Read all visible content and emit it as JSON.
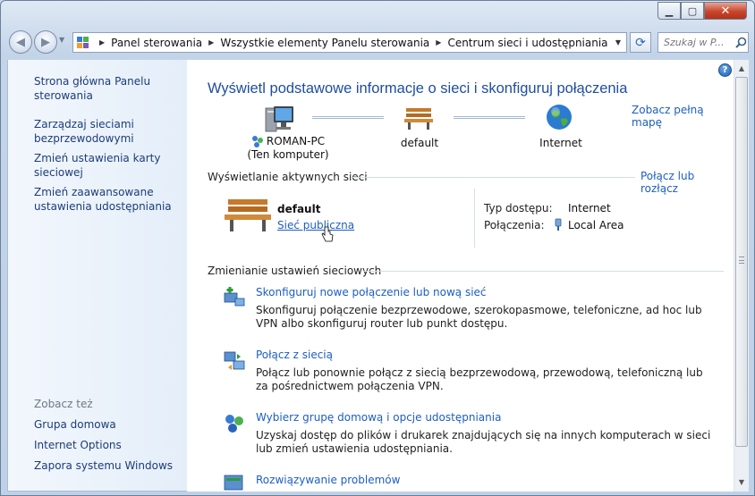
{
  "window": {
    "min_glyph": "▁",
    "max_glyph": "▢",
    "close_glyph": "✕"
  },
  "address_bar": {
    "crumbs": [
      "Panel sterowania",
      "Wszystkie elementy Panelu sterowania",
      "Centrum sieci i udostępniania"
    ]
  },
  "search": {
    "placeholder": "Szukaj w P..."
  },
  "left_pane": {
    "home_link_l1": "Strona główna Panelu",
    "home_link_l2": "sterowania",
    "links": [
      {
        "l1": "Zarządzaj sieciami",
        "l2": "bezprzewodowymi"
      },
      {
        "l1": "Zmień ustawienia karty",
        "l2": "sieciowej"
      },
      {
        "l1": "Zmień zaawansowane",
        "l2": "ustawienia udostępniania"
      }
    ],
    "see_also_heading": "Zobacz też",
    "see_also": [
      "Grupa domowa",
      "Internet Options",
      "Zapora systemu Windows"
    ]
  },
  "content": {
    "title": "Wyświetl podstawowe informacje o sieci i skonfiguruj połączenia",
    "see_full_map": "Zobacz pełną mapę",
    "map": {
      "computer_name": "ROMAN-PC",
      "computer_sub": "(Ten komputer)",
      "network_name": "default",
      "internet": "Internet"
    },
    "active_section": {
      "heading": "Wyświetlanie aktywnych sieci",
      "action": "Połącz lub rozłącz",
      "network_name": "default",
      "network_type": "Sieć publiczna",
      "access_type_label": "Typ dostępu:",
      "access_type_value": "Internet",
      "connections_label": "Połączenia:",
      "connections_value": "Local Area"
    },
    "change_section": {
      "heading": "Zmienianie ustawień sieciowych",
      "tasks": [
        {
          "title": "Skonfiguruj nowe połączenie lub nową sieć",
          "desc": "Skonfiguruj połączenie bezprzewodowe, szerokopasmowe, telefoniczne, ad hoc lub VPN albo skonfiguruj router lub punkt dostępu."
        },
        {
          "title": "Połącz z siecią",
          "desc": "Połącz lub ponownie połącz z siecią bezprzewodową, przewodową, telefoniczną lub za pośrednictwem połączenia VPN."
        },
        {
          "title": "Wybierz grupę domową i opcje udostępniania",
          "desc": "Uzyskaj dostęp do plików i drukarek znajdujących się na innych komputerach w sieci lub zmień ustawienia udostępniania."
        },
        {
          "title": "Rozwiązywanie problemów",
          "desc": ""
        }
      ]
    }
  },
  "colors": {
    "link": "#1d5ec2",
    "title": "#1f4da0",
    "left_link": "#1d3c7a"
  }
}
